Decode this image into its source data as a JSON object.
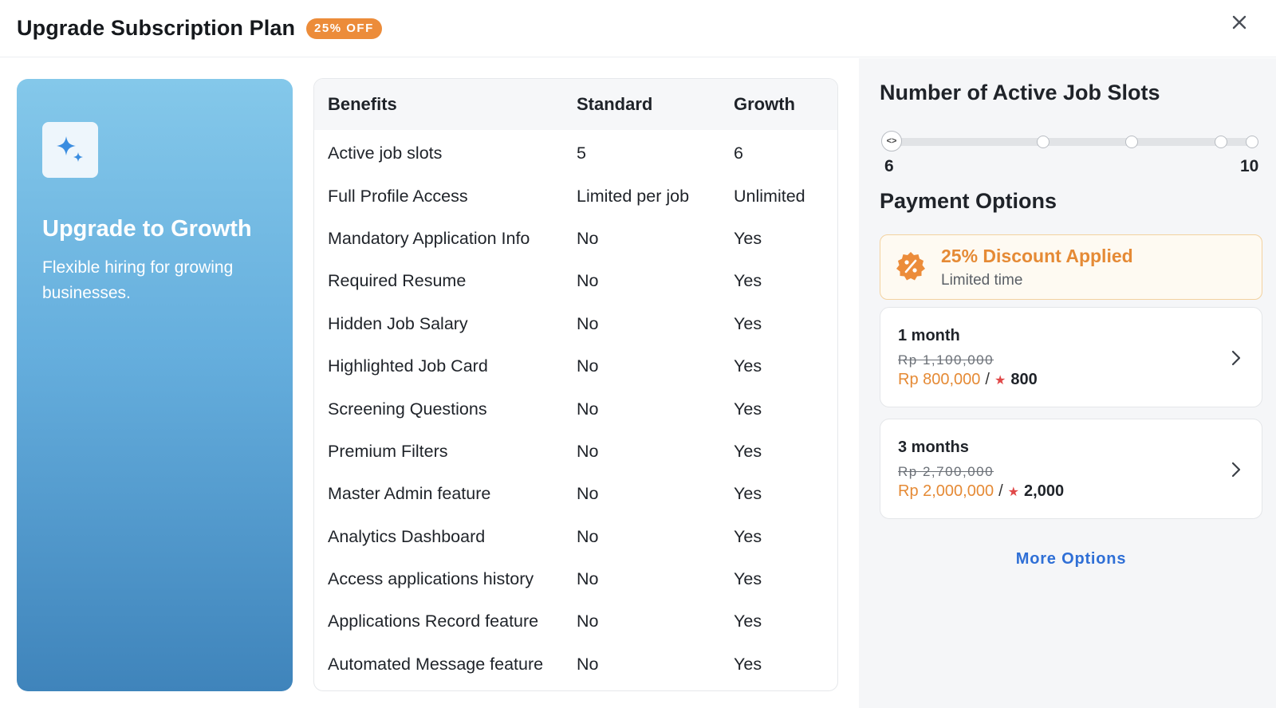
{
  "header": {
    "title": "Upgrade Subscription Plan",
    "badge": "25% OFF",
    "close_icon": "close-icon"
  },
  "promo": {
    "icon": "sparkle-icon",
    "title": "Upgrade to Growth",
    "description": "Flexible hiring for growing businesses."
  },
  "benefits_table": {
    "headers": [
      "Benefits",
      "Standard",
      "Growth"
    ],
    "rows": [
      [
        "Active job slots",
        "5",
        "6"
      ],
      [
        "Full Profile Access",
        "Limited per job",
        "Unlimited"
      ],
      [
        "Mandatory Application Info",
        "No",
        "Yes"
      ],
      [
        "Required Resume",
        "No",
        "Yes"
      ],
      [
        "Hidden Job Salary",
        "No",
        "Yes"
      ],
      [
        "Highlighted Job Card",
        "No",
        "Yes"
      ],
      [
        "Screening Questions",
        "No",
        "Yes"
      ],
      [
        "Premium Filters",
        "No",
        "Yes"
      ],
      [
        "Master Admin feature",
        "No",
        "Yes"
      ],
      [
        "Analytics Dashboard",
        "No",
        "Yes"
      ],
      [
        "Access applications history",
        "No",
        "Yes"
      ],
      [
        "Applications Record feature",
        "No",
        "Yes"
      ],
      [
        "Automated Message feature",
        "No",
        "Yes"
      ]
    ]
  },
  "job_slots": {
    "title": "Number of Active Job Slots",
    "min_label": "6",
    "max_label": "10",
    "min": 6,
    "max": 10,
    "value": 6,
    "thumb_symbol": "<>"
  },
  "payment": {
    "title": "Payment Options",
    "discount": {
      "icon": "discount-badge-icon",
      "title": "25% Discount Applied",
      "subtitle": "Limited time"
    },
    "options": [
      {
        "duration": "1 month",
        "old_price": "Rp 1,100,000",
        "price": "Rp 800,000",
        "separator": "/",
        "star": "★",
        "points": "800"
      },
      {
        "duration": "3 months",
        "old_price": "Rp 2,700,000",
        "price": "Rp 2,000,000",
        "separator": "/",
        "star": "★",
        "points": "2,000"
      }
    ],
    "more_options": "More Options"
  },
  "colors": {
    "accent_orange": "#e58a35",
    "link_blue": "#2f6fd6",
    "star_red": "#e04848"
  }
}
